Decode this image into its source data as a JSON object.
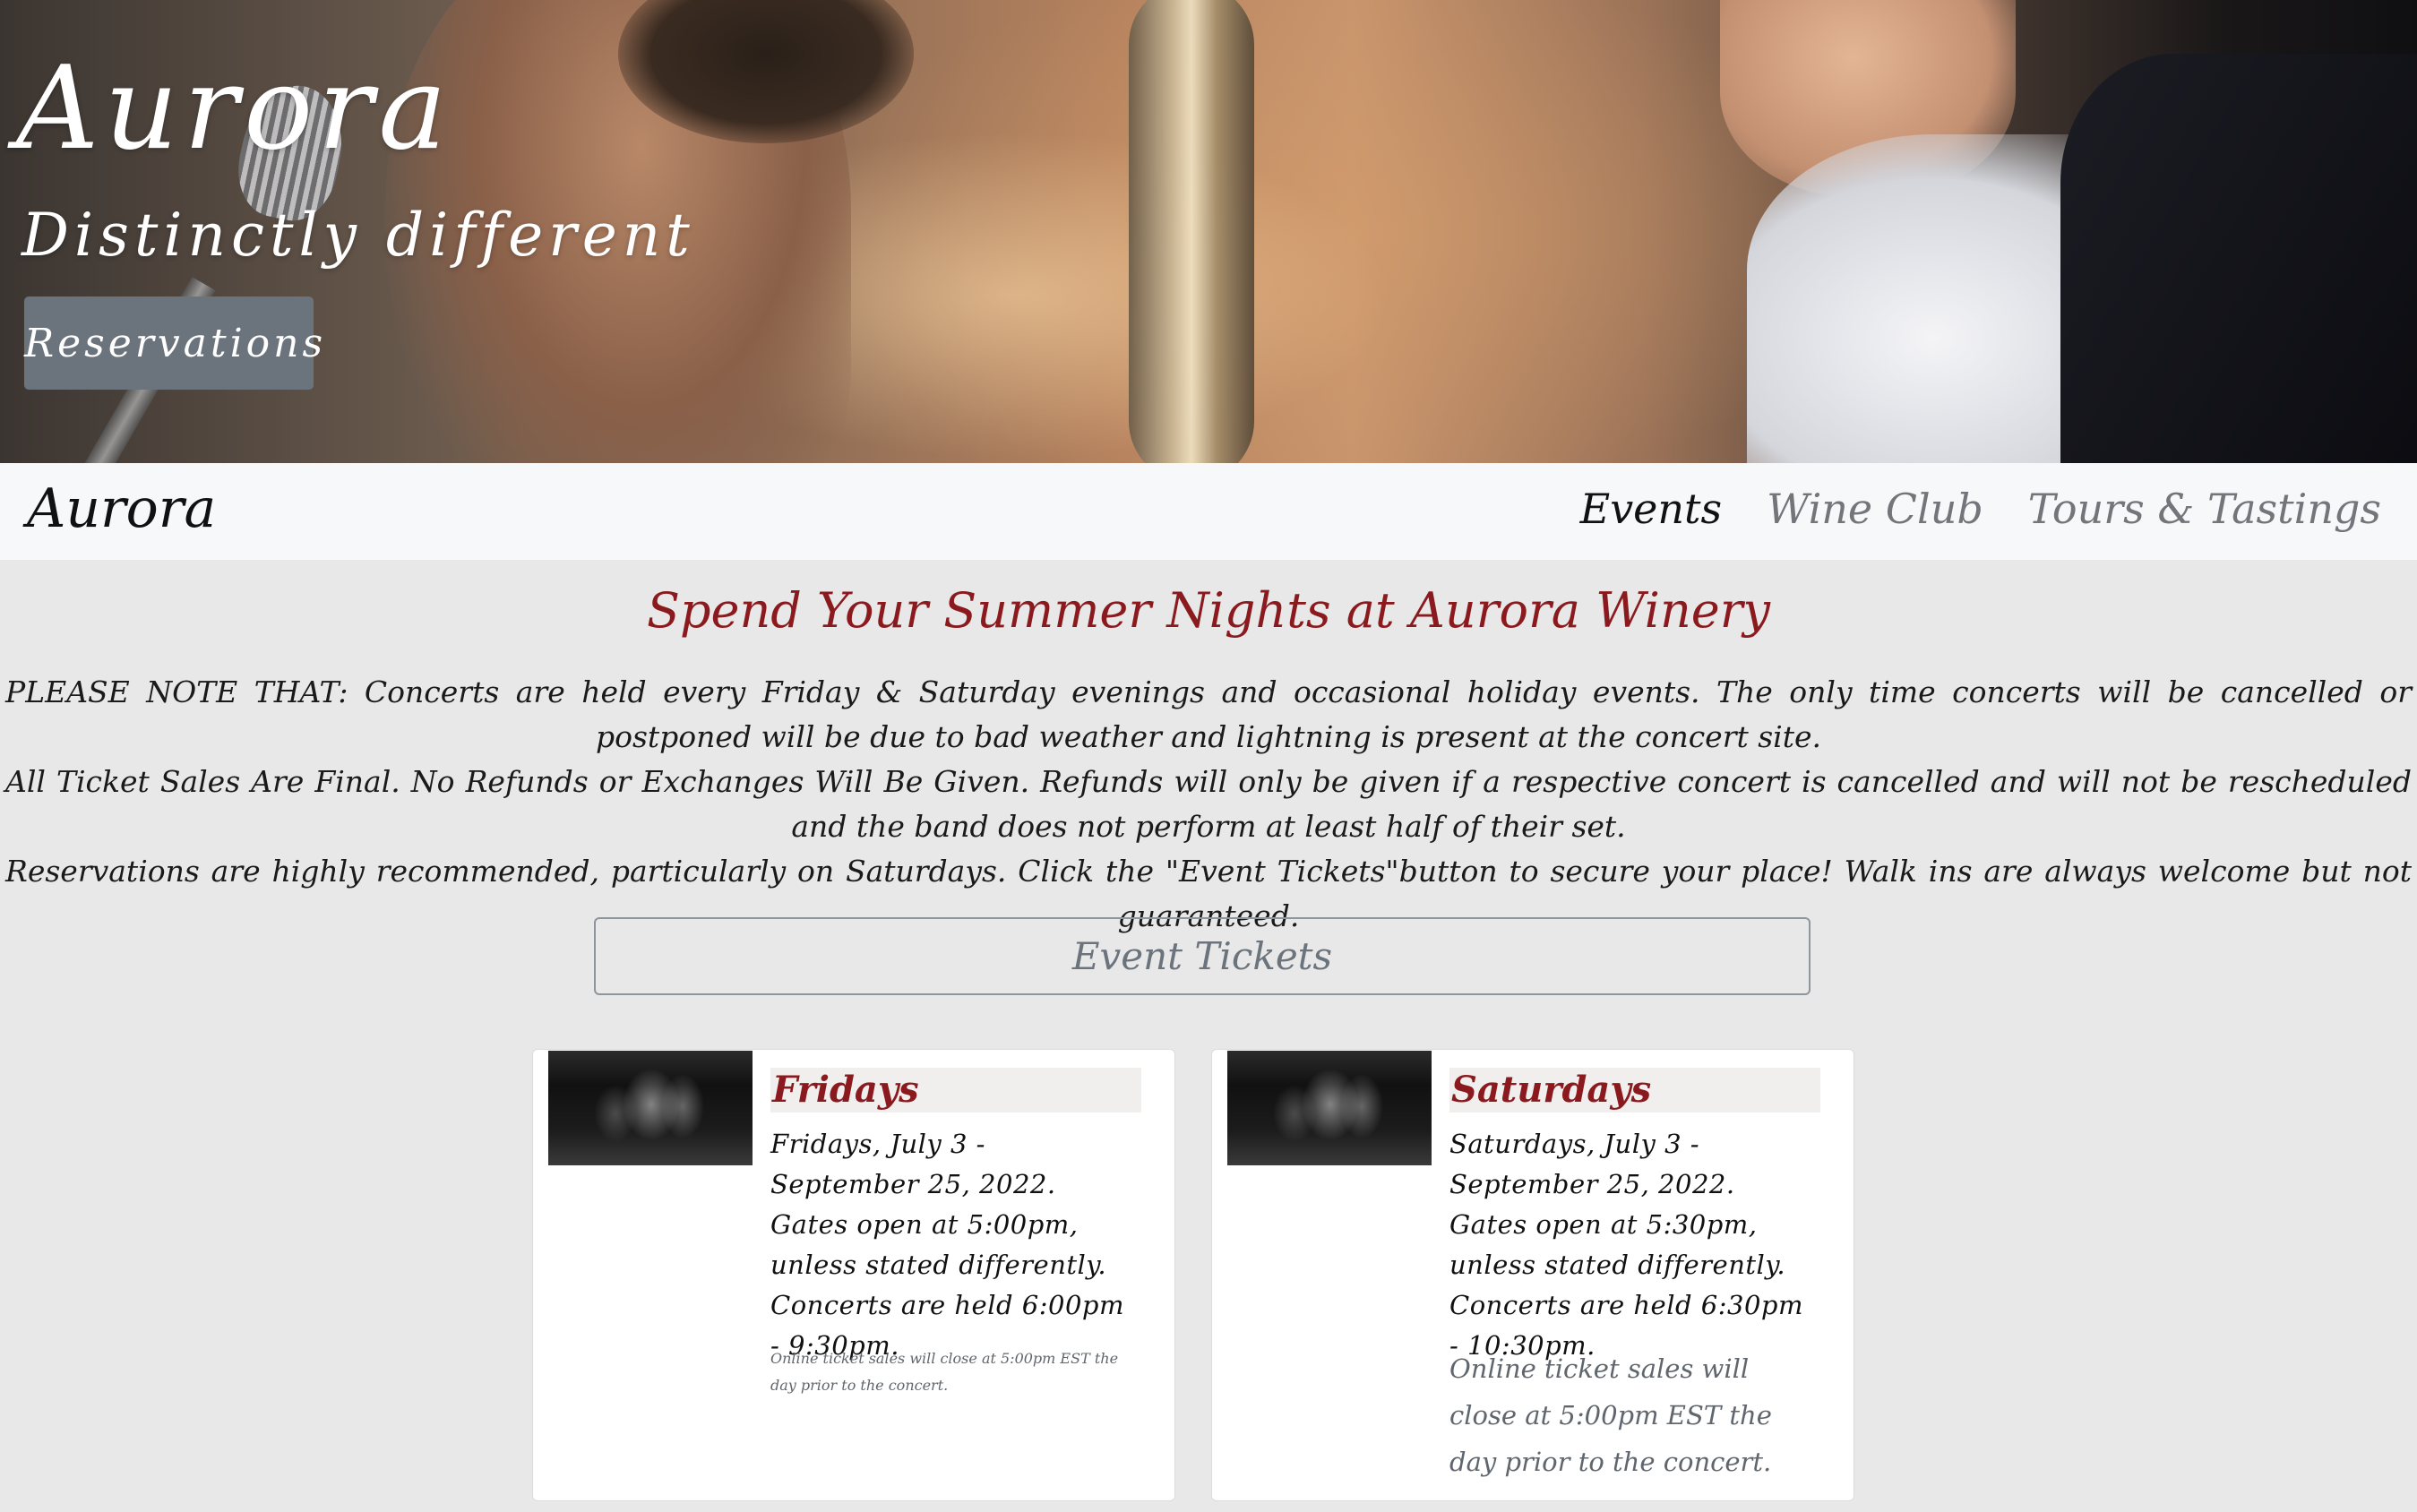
{
  "hero": {
    "title": "Aurora",
    "subtitle": "Distinctly different",
    "reservations_label": "Reservations"
  },
  "navbar": {
    "brand": "Aurora",
    "links": [
      {
        "label": "Events",
        "active": true
      },
      {
        "label": "Wine Club",
        "active": false
      },
      {
        "label": "Tours & Tastings",
        "active": false
      }
    ]
  },
  "main": {
    "heading": "Spend Your Summer Nights at Aurora Winery",
    "notes": [
      "PLEASE NOTE THAT: Concerts are held every Friday & Saturday evenings and occasional holiday events. The only time concerts will be cancelled or postponed will be due to bad weather and lightning is present at the concert site.",
      "All Ticket Sales Are Final. No Refunds or Exchanges Will Be Given. Refunds will only be given if a respective concert is cancelled and will not be rescheduled and the band does not perform at least half of their set.",
      "Reservations are highly recommended, particularly on Saturdays. Click the \"Event Tickets\"button to secure your place! Walk ins are always welcome but not guaranteed."
    ],
    "event_tickets_label": "Event Tickets"
  },
  "cards": [
    {
      "title": "Fridays",
      "description": "Fridays, July 3 - September 25, 2022. Gates open at 5:00pm, unless stated differently. Concerts are held 6:00pm - 9:30pm.",
      "note": "Online ticket sales will close at 5:00pm EST the day prior to the concert."
    },
    {
      "title": "Saturdays",
      "description": "Saturdays, July 3 - September 25, 2022. Gates open at 5:30pm, unless stated differently. Concerts are held 6:30pm - 10:30pm.",
      "note": "Online ticket sales will close at 5:00pm EST the day prior to the concert."
    }
  ],
  "colors": {
    "accent_red": "#8b1a1f",
    "button_gray": "#6b737c",
    "page_bg": "#e8e8e8",
    "navbar_bg": "#f7f8fa"
  }
}
